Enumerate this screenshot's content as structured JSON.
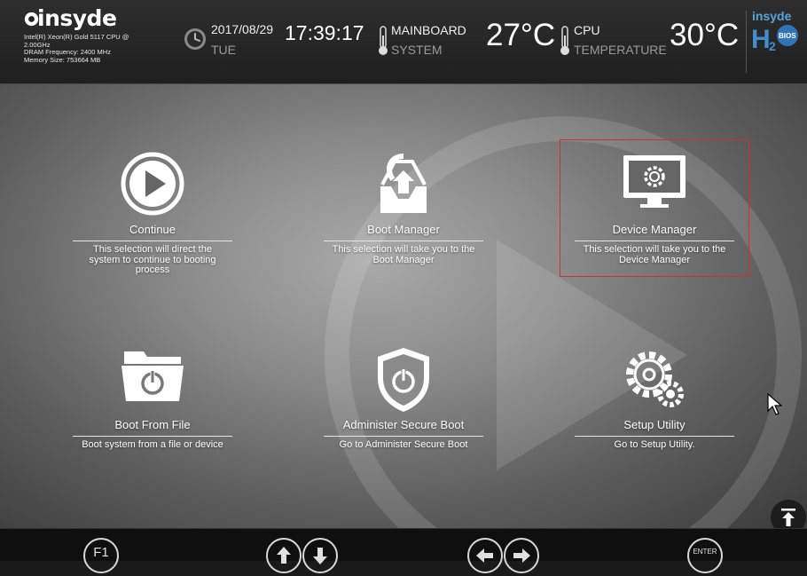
{
  "header": {
    "brand": "insyde",
    "cpu": "Intel(R) Xeon(R) Gold 5117 CPU @ 2.00GHz",
    "dram": "DRAM Frequency: 2400 MHz",
    "memory": "Memory Size: 753664 MB",
    "date": "2017/08/29",
    "day": "TUE",
    "time": "17:39:17",
    "mainboard_label": "MAINBOARD",
    "system_label": "SYSTEM",
    "system_temp": "27°C",
    "cpu_label": "CPU",
    "temperature_label": "TEMPERATURE",
    "cpu_temp": "30°C",
    "h2o_top": "insyde",
    "h2o_bios": "BIOS"
  },
  "tiles": [
    {
      "title": "Continue",
      "desc": "This selection will direct the system to continue to booting process",
      "icon": "play-circle-icon"
    },
    {
      "title": "Boot Manager",
      "desc": "This selection will take you to the Boot Manager",
      "icon": "boot-manager-icon"
    },
    {
      "title": "Device Manager",
      "desc": "This selection will take you to the Device Manager",
      "icon": "monitor-gear-icon"
    },
    {
      "title": "Boot From File",
      "desc": "Boot system from a file or device",
      "icon": "folder-power-icon"
    },
    {
      "title": "Administer Secure Boot",
      "desc": "Go to Administer Secure Boot",
      "icon": "shield-power-icon"
    },
    {
      "title": "Setup Utility",
      "desc": "Go to Setup Utility.",
      "icon": "gears-icon"
    }
  ],
  "selected_tile": "Device Manager",
  "footer": {
    "f1": "F1",
    "enter": "ENTER"
  }
}
